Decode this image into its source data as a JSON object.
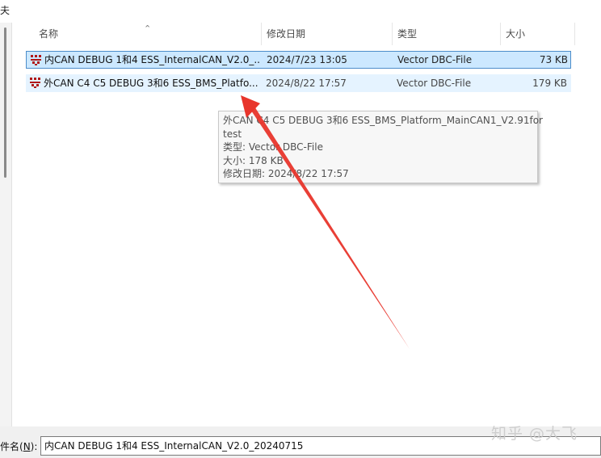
{
  "top": {
    "cut_text": "夫"
  },
  "columns": {
    "name": "名称",
    "date": "修改日期",
    "type": "类型",
    "size": "大小"
  },
  "files": [
    {
      "name": "内CAN DEBUG 1和4 ESS_InternalCAN_V2.0_...",
      "date": "2024/7/23 13:05",
      "type": "Vector DBC-File",
      "size": "73 KB",
      "state": "selected"
    },
    {
      "name": "外CAN C4 C5 DEBUG 3和6 ESS_BMS_Platfo...",
      "date": "2024/8/22 17:57",
      "type": "Vector DBC-File",
      "size": "179 KB",
      "state": "hover"
    }
  ],
  "tooltip": {
    "line1": "外CAN C4 C5 DEBUG 3和6 ESS_BMS_Platform_MainCAN1_V2.91for",
    "line2": "test",
    "line3": "类型: Vector DBC-File",
    "line4": "大小: 178 KB",
    "line5": "修改日期: 2024/8/22 17:57"
  },
  "filename_bar": {
    "label_prefix": "件名(",
    "label_key": "N",
    "label_suffix": "):",
    "value": "内CAN DEBUG 1和4 ESS_InternalCAN_V2.0_20240715"
  },
  "watermark": "知乎 @大飞",
  "colors": {
    "selected_bg": "#cce8ff",
    "selected_border": "#4c8dca",
    "hover_bg": "#e5f3ff",
    "arrow": "#e8352b",
    "dbc_icon": "#b01818"
  },
  "icons": {
    "file_icon": "dbc-file-icon"
  }
}
